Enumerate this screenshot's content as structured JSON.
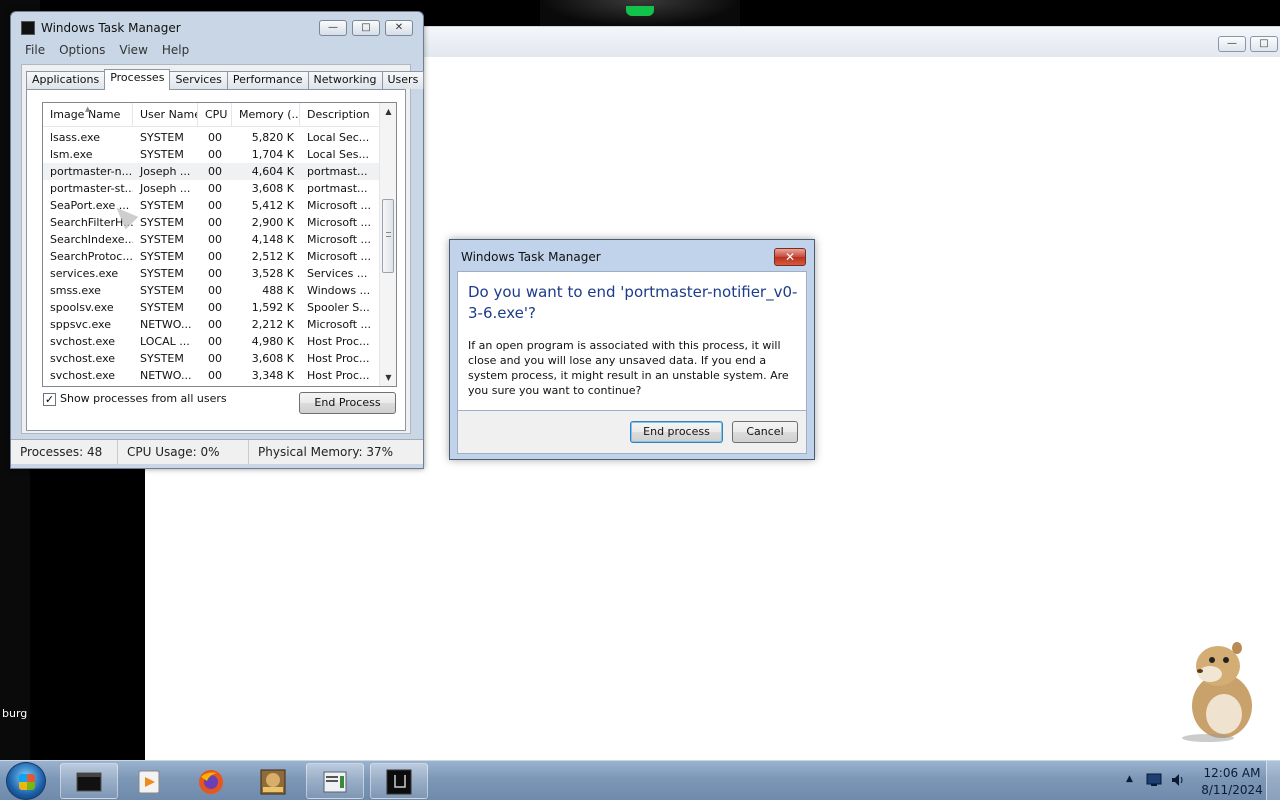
{
  "task_manager": {
    "title": "Windows Task Manager",
    "menu": [
      "File",
      "Options",
      "View",
      "Help"
    ],
    "tabs": [
      "Applications",
      "Processes",
      "Services",
      "Performance",
      "Networking",
      "Users"
    ],
    "active_tab": "Processes",
    "columns": [
      "Image Name",
      "User Name",
      "CPU",
      "Memory (...",
      "Description"
    ],
    "rows": [
      [
        "lsass.exe",
        "SYSTEM",
        "00",
        "5,820 K",
        "Local Sec..."
      ],
      [
        "lsm.exe",
        "SYSTEM",
        "00",
        "1,704 K",
        "Local Ses..."
      ],
      [
        "portmaster-n...",
        "Joseph ...",
        "00",
        "4,604 K",
        "portmast..."
      ],
      [
        "portmaster-st...",
        "Joseph ...",
        "00",
        "3,608 K",
        "portmast..."
      ],
      [
        "SeaPort.exe ...",
        "SYSTEM",
        "00",
        "5,412 K",
        "Microsoft ..."
      ],
      [
        "SearchFilterH...",
        "SYSTEM",
        "00",
        "2,900 K",
        "Microsoft ..."
      ],
      [
        "SearchIndexe...",
        "SYSTEM",
        "00",
        "4,148 K",
        "Microsoft ..."
      ],
      [
        "SearchProtoc...",
        "SYSTEM",
        "00",
        "2,512 K",
        "Microsoft ..."
      ],
      [
        "services.exe",
        "SYSTEM",
        "00",
        "3,528 K",
        "Services ..."
      ],
      [
        "smss.exe",
        "SYSTEM",
        "00",
        "488 K",
        "Windows ..."
      ],
      [
        "spoolsv.exe",
        "SYSTEM",
        "00",
        "1,592 K",
        "Spooler S..."
      ],
      [
        "sppsvc.exe",
        "NETWO...",
        "00",
        "2,212 K",
        "Microsoft ..."
      ],
      [
        "svchost.exe",
        "LOCAL ...",
        "00",
        "4,980 K",
        "Host Proc..."
      ],
      [
        "svchost.exe",
        "SYSTEM",
        "00",
        "3,608 K",
        "Host Proc..."
      ],
      [
        "svchost.exe",
        "NETWO...",
        "00",
        "3,348 K",
        "Host Proc..."
      ]
    ],
    "selected_row": 2,
    "show_all_users_label": "Show processes from all users",
    "show_all_users_checked": true,
    "end_process_label": "End Process",
    "status": {
      "processes": "Processes: 48",
      "cpu": "CPU Usage: 0%",
      "memory": "Physical Memory: 37%"
    }
  },
  "dialog": {
    "title": "Windows Task Manager",
    "heading": "Do you want to end 'portmaster-notifier_v0-3-6.exe'?",
    "body": "If an open program is associated with this process, it will close and you will lose any unsaved data. If you end a system process, it might result in an unstable system. Are you sure you want to continue?",
    "confirm_label": "End process",
    "cancel_label": "Cancel"
  },
  "taskbar": {
    "time": "12:06 AM",
    "date": "8/11/2024",
    "pinned_icons": [
      "terminal-icon",
      "media-player-icon",
      "firefox-icon",
      "box-app-icon",
      "task-manager-icon",
      "console-icon"
    ]
  },
  "desktop": {
    "labels": [
      "burg"
    ]
  },
  "colors": {
    "dialog_heading": "#1c3b8a",
    "close_button": "#c8473a",
    "taskbar": "#7d97b7"
  }
}
